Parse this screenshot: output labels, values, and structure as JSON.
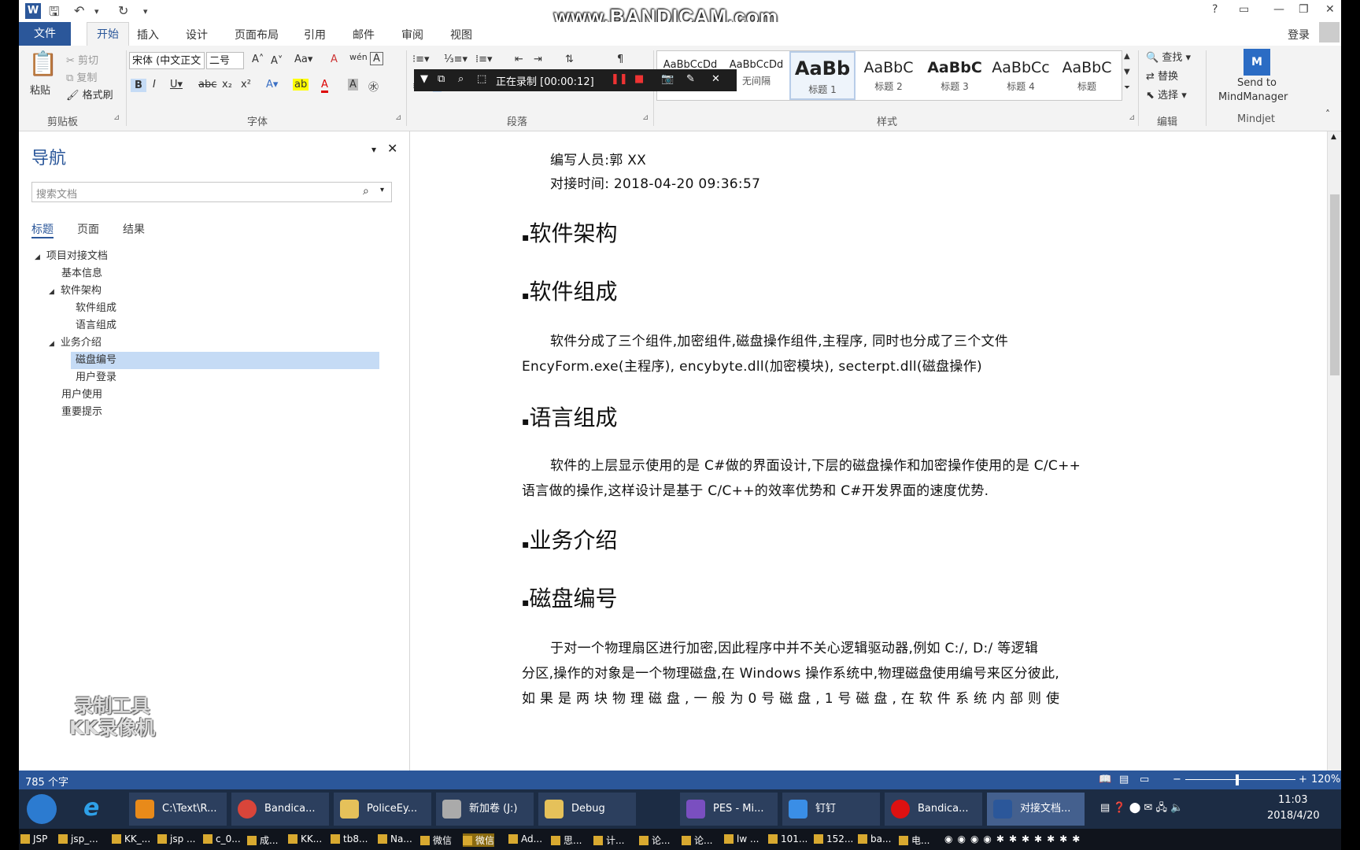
{
  "watermark": "www.BANDICAM.com",
  "window": {
    "help": "?",
    "min": "—",
    "restore": "❐",
    "close": "✕",
    "login": "登录"
  },
  "tabs": {
    "file": "文件",
    "home": "开始",
    "insert": "插入",
    "design": "设计",
    "layout": "页面布局",
    "references": "引用",
    "mailings": "邮件",
    "review": "审阅",
    "view": "视图"
  },
  "ribbon": {
    "clipboard": {
      "paste": "粘贴",
      "cut": "剪切",
      "copy": "复制",
      "format_painter": "格式刷",
      "label": "剪贴板"
    },
    "font": {
      "name": "宋体 (中文正文",
      "size": "二号",
      "label": "字体"
    },
    "paragraph": {
      "label": "段落"
    },
    "styles": {
      "label": "样式",
      "items": [
        {
          "preview": "AaBbCcDd",
          "name": "正文"
        },
        {
          "preview": "AaBbCcDd",
          "name": "无间隔"
        },
        {
          "preview": "AaBb",
          "name": "标题 1"
        },
        {
          "preview": "AaBbC",
          "name": "标题 2"
        },
        {
          "preview": "AaBbC",
          "name": "标题 3"
        },
        {
          "preview": "AaBbCc",
          "name": "标题 4"
        },
        {
          "preview": "AaBbC",
          "name": "标题"
        }
      ]
    },
    "editing": {
      "find": "查找",
      "replace": "替换",
      "select": "选择",
      "label": "编辑"
    },
    "mindjet": {
      "send_line1": "Send to",
      "send_line2": "MindManager",
      "label": "Mindjet"
    }
  },
  "recorder": {
    "status": "正在录制 [00:00:12]"
  },
  "nav": {
    "title": "导航",
    "search_placeholder": "搜索文档",
    "tabs": [
      "标题",
      "页面",
      "结果"
    ],
    "tree": [
      {
        "label": "项目对接文档",
        "toggle": "◢"
      },
      {
        "label": "基本信息"
      },
      {
        "label": "软件架构",
        "toggle": "◢"
      },
      {
        "label": "软件组成"
      },
      {
        "label": "语言组成"
      },
      {
        "label": "业务介绍",
        "toggle": "◢"
      },
      {
        "label": "磁盘编号"
      },
      {
        "label": "用户登录"
      },
      {
        "label": "用户使用"
      },
      {
        "label": "重要提示"
      }
    ],
    "overlay_line1": "录制工具",
    "overlay_line2": "KK录像机"
  },
  "doc": {
    "author": "编写人员:郭 XX",
    "time": "对接时间: 2018-04-20 09:36:57",
    "h_arch": "软件架构",
    "h_comp": "软件组成",
    "p_comp_1": "软件分成了三个组件,加密组件,磁盘操作组件,主程序,  同时也分成了三个文件",
    "p_comp_2": "EncyForm.exe(主程序), encybyte.dll(加密模块), secterpt.dll(磁盘操作)",
    "h_lang": "语言组成",
    "p_lang_1": "软件的上层显示使用的是 C#做的界面设计,下层的磁盘操作和加密操作使用的是 C/C++",
    "p_lang_2": "语言做的操作,这样设计是基于 C/C++的效率优势和 C#开发界面的速度优势.",
    "h_biz": "业务介绍",
    "h_disk": "磁盘编号",
    "p_disk_1": "于对一个物理扇区进行加密,因此程序中并不关心逻辑驱动器,例如 C:/,  D:/  等逻辑",
    "p_disk_2": "分区,操作的对象是一个物理磁盘,在 Windows 操作系统中,物理磁盘使用编号来区分彼此,",
    "p_disk_3": "如 果 是 两 块 物 理 磁 盘 , 一 般 为  0  号 磁 盘 , 1  号 磁 盘 , 在 软 件 系 统 内 部 则 使"
  },
  "status": {
    "words": "785 个字",
    "zoom": "120%"
  },
  "taskbar": {
    "items": [
      "C:\\Text\\R...",
      "Bandica...",
      "PoliceEy...",
      "新加卷 (J:)",
      "Debug",
      "PES - Mi...",
      "钉钉",
      "Bandica...",
      "对接文档..."
    ],
    "time": "11:03",
    "date": "2018/4/20"
  },
  "taskbar2": [
    "JSP",
    "jsp_...",
    "KK_...",
    "jsp ...",
    "c_0...",
    "成...",
    "KK...",
    "tb8...",
    "Na...",
    "微信",
    "微信",
    "Ad...",
    "思...",
    "计...",
    "论...",
    "论...",
    "lw ...",
    "101...",
    "152...",
    "ba...",
    "电..."
  ]
}
